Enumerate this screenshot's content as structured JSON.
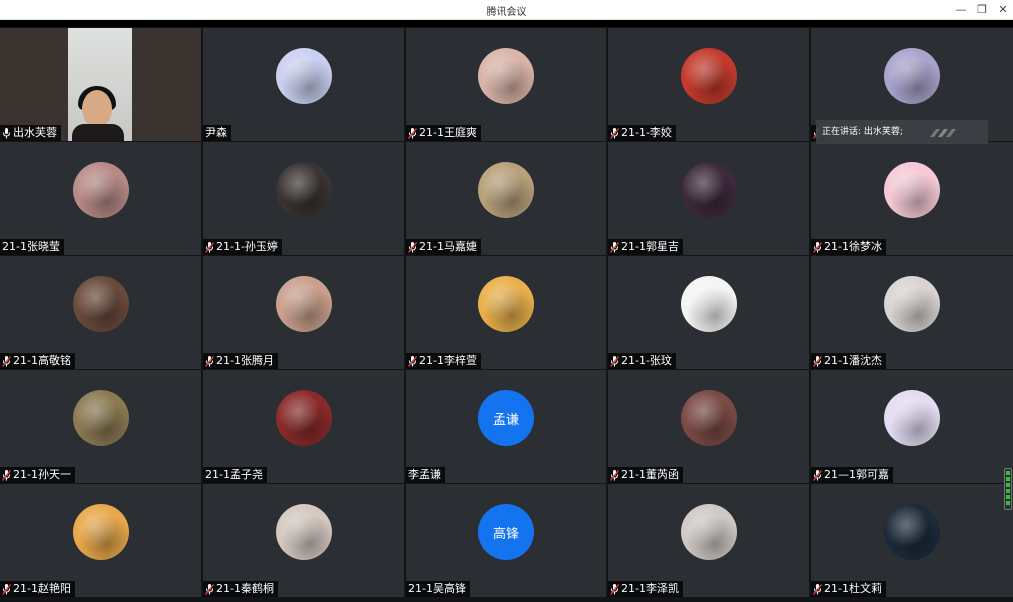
{
  "window": {
    "title": "腾讯会议",
    "minimize": "—",
    "restore": "❐",
    "close": "✕"
  },
  "speaking_indicator": "正在讲话: 出水芙蓉;",
  "colors": {
    "grid_bg": "#121418",
    "tile_bg": "#2b2e32",
    "active_border": "#16c25a",
    "text_avatar_bg": "#1474f0"
  },
  "participants": [
    {
      "name": "出水芙蓉",
      "mic": "on",
      "video": true
    },
    {
      "name": "尹森",
      "mic": "none",
      "avatar_color": "#c9cff0"
    },
    {
      "name": "21-1王庭爽",
      "mic": "muted",
      "avatar_color": "#d9b3a8"
    },
    {
      "name": "21-1-李姣",
      "mic": "muted",
      "avatar_color": "#c43a2c"
    },
    {
      "name": "",
      "mic": "muted",
      "avatar_color": "#a9a3cc"
    },
    {
      "name": "21-1张晓莹",
      "mic": "none",
      "avatar_color": "#b78a86"
    },
    {
      "name": "21-1-孙玉婷",
      "mic": "muted",
      "avatar_color": "#3a3432"
    },
    {
      "name": "21-1马嘉婕",
      "mic": "muted",
      "avatar_color": "#b8a07a"
    },
    {
      "name": "21-1郭星吉",
      "mic": "muted",
      "avatar_color": "#3d2a3c"
    },
    {
      "name": "21-1徐梦冰",
      "mic": "muted",
      "avatar_color": "#f5c9d6"
    },
    {
      "name": "21-1高敬铭",
      "mic": "muted",
      "avatar_color": "#6a4a3c"
    },
    {
      "name": "21-1张腾月",
      "mic": "muted",
      "avatar_color": "#caa08c"
    },
    {
      "name": "21-1李梓萱",
      "mic": "muted",
      "avatar_color": "#e8b04a"
    },
    {
      "name": "21-1-张玟",
      "mic": "muted",
      "avatar_color": "#f4f4f4"
    },
    {
      "name": "21-1潘沈杰",
      "mic": "muted",
      "avatar_color": "#d9d4d0"
    },
    {
      "name": "21-1孙天一",
      "mic": "muted",
      "avatar_color": "#8b7a52"
    },
    {
      "name": "21-1孟子尧",
      "mic": "none",
      "avatar_color": "#8a2a2a"
    },
    {
      "name": "李孟谦",
      "mic": "none",
      "avatar_text": "孟谦"
    },
    {
      "name": "21-1董芮函",
      "mic": "muted",
      "avatar_color": "#7a4a44"
    },
    {
      "name": "21—1郭可嘉",
      "mic": "muted",
      "avatar_color": "#e3dcf3"
    },
    {
      "name": "21-1赵艳阳",
      "mic": "muted",
      "avatar_color": "#e8a84a"
    },
    {
      "name": "21-1秦鹤桐",
      "mic": "muted",
      "avatar_color": "#d4c8c0"
    },
    {
      "name": "21-1吴高锋",
      "mic": "none",
      "avatar_text": "高锋"
    },
    {
      "name": "21-1李泽凯",
      "mic": "muted",
      "avatar_color": "#cfc9c4"
    },
    {
      "name": "21-1杜文莉",
      "mic": "muted",
      "avatar_color": "#1d2a3a"
    }
  ]
}
